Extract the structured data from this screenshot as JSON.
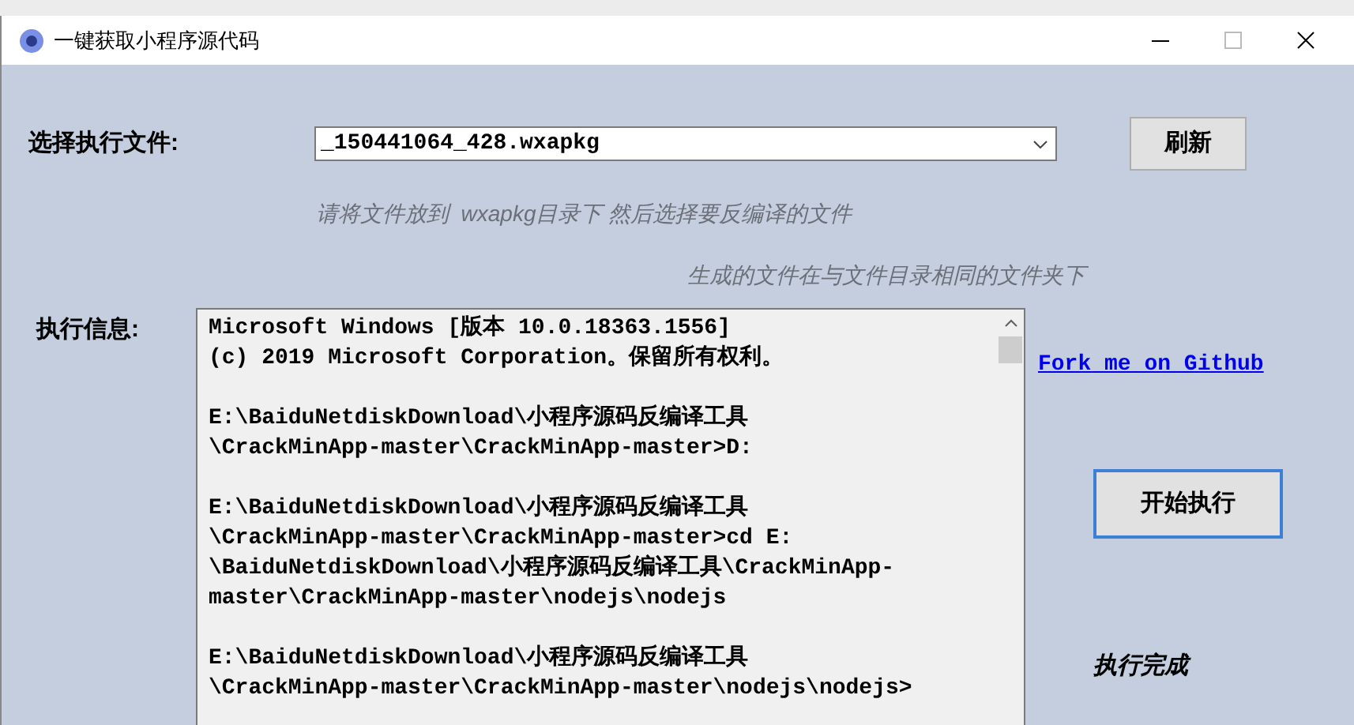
{
  "window": {
    "title": "一键获取小程序源代码"
  },
  "file_label": "选择执行文件:",
  "file_select": {
    "value": "_150441064_428.wxapkg"
  },
  "refresh_button": "刷新",
  "hints": [
    "请将文件放到  wxapkg目录下 然后选择要反编译的文件",
    "生成的文件在与文件目录相同的文件夹下"
  ],
  "output_label": "执行信息:",
  "output_blocks": [
    [
      "Microsoft Windows [版本 10.0.18363.1556]",
      "(c) 2019 Microsoft Corporation。保留所有权利。"
    ],
    [
      "E:\\BaiduNetdiskDownload\\小程序源码反编译工具",
      "\\CrackMinApp-master\\CrackMinApp-master>D:"
    ],
    [
      "E:\\BaiduNetdiskDownload\\小程序源码反编译工具",
      "\\CrackMinApp-master\\CrackMinApp-master>cd E:",
      "\\BaiduNetdiskDownload\\小程序源码反编译工具\\CrackMinApp-",
      "master\\CrackMinApp-master\\nodejs\\nodejs"
    ],
    [
      "E:\\BaiduNetdiskDownload\\小程序源码反编译工具",
      "\\CrackMinApp-master\\CrackMinApp-master\\nodejs\\nodejs>"
    ]
  ],
  "github_link": "Fork me on Github",
  "start_button": "开始执行",
  "status": "执行完成"
}
